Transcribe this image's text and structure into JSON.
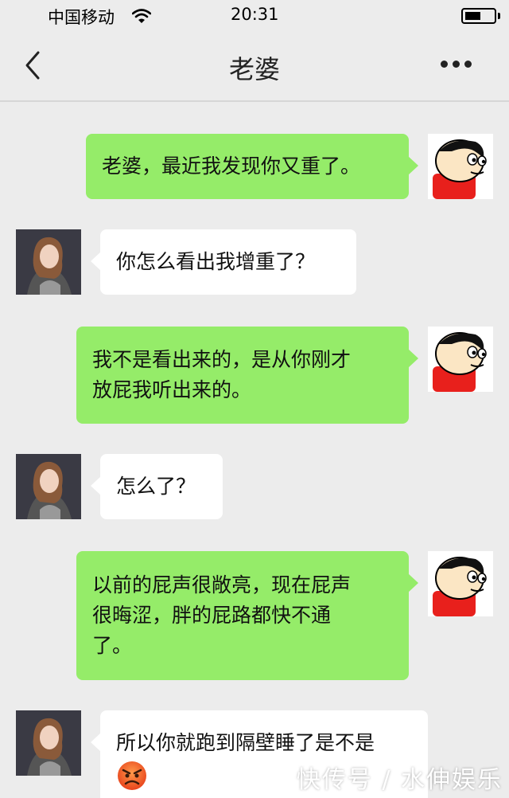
{
  "status_bar": {
    "carrier": "中国移动",
    "time": "20:31",
    "battery_level": 0.55
  },
  "nav": {
    "title": "老婆"
  },
  "messages": [
    {
      "sender": "me",
      "text": "老婆，最近我发现你又重了。"
    },
    {
      "sender": "her",
      "text": "你怎么看出我增重了？"
    },
    {
      "sender": "me",
      "text": "我不是看出来的，是从你刚才\n放屁我听出来的。"
    },
    {
      "sender": "her",
      "text": "怎么了？"
    },
    {
      "sender": "me",
      "text": "以前的屁声很敞亮，现在屁声\n很晦涩，胖的屁路都快不通\n了。"
    },
    {
      "sender": "her",
      "text": "所以你就跑到隔壁睡了是不是",
      "emoji": "angry-face-icon"
    }
  ],
  "watermark": "快传号 / 水伸娱乐",
  "colors": {
    "my_bubble": "#95ec69",
    "her_bubble": "#ffffff",
    "background": "#ececec"
  }
}
